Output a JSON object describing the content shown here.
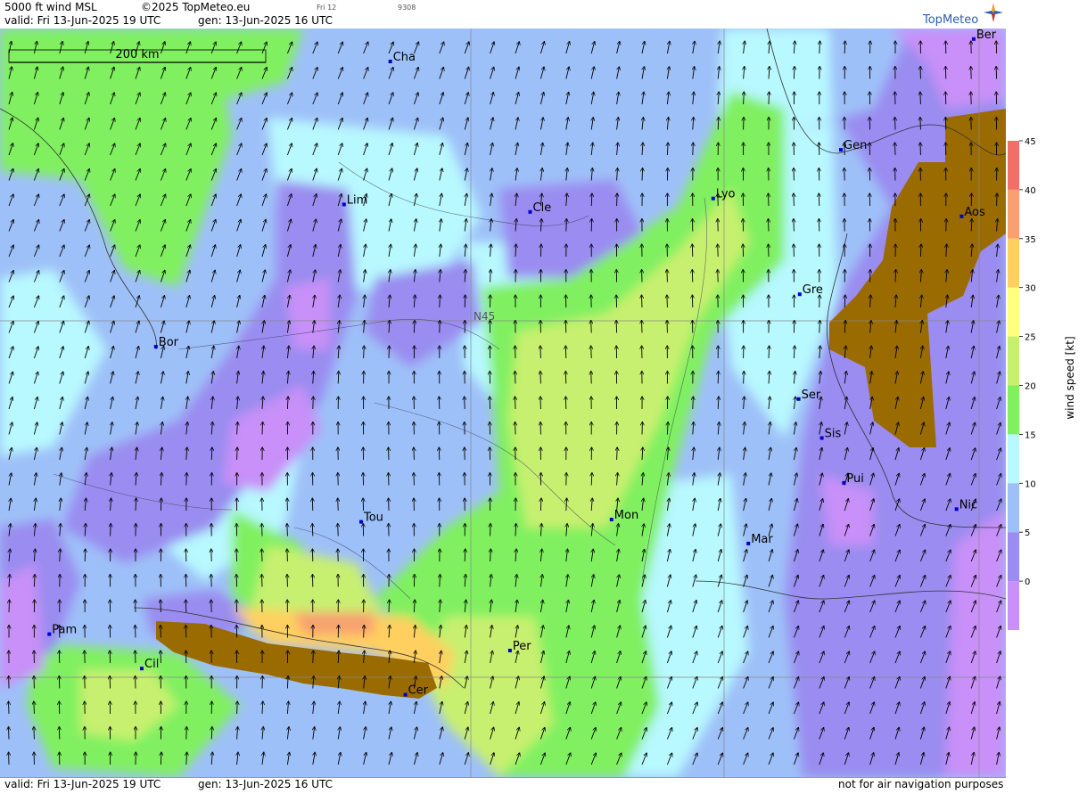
{
  "header": {
    "product": "5000 ft wind MSL",
    "copyright": "©2025 TopMeteo.eu",
    "frame_day": "Fri 12",
    "frame_code": "9308",
    "valid": "valid:  Fri  13-Jun-2025  19 UTC",
    "gen": "gen: 13-Jun-2025 16 UTC"
  },
  "footer": {
    "valid": "valid:  Fri  13-Jun-2025  19 UTC",
    "gen": "gen: 13-Jun-2025 16 UTC",
    "disclaimer": "not for air navigation purposes"
  },
  "logo": {
    "text": "TopMeteo"
  },
  "scale_bar": {
    "label": "200 km"
  },
  "grid_label": "N45",
  "legend": {
    "title": "wind speed [kt]",
    "ticks": [
      "45",
      "40",
      "35",
      "30",
      "25",
      "20",
      "15",
      "10",
      "5",
      "0"
    ],
    "colors": [
      "#f07068",
      "#f8a070",
      "#ffd060",
      "#ffff80",
      "#c8f070",
      "#80f060",
      "#b8f8ff",
      "#9ec0f8",
      "#9a8cf0",
      "#c890f8"
    ]
  },
  "cities": [
    {
      "name": "Cha",
      "fx": 0.388,
      "fy": 0.044
    },
    {
      "name": "Ber",
      "fx": 0.968,
      "fy": 0.014
    },
    {
      "name": "Gen",
      "fx": 0.836,
      "fy": 0.162
    },
    {
      "name": "Lim",
      "fx": 0.342,
      "fy": 0.235
    },
    {
      "name": "Cle",
      "fx": 0.527,
      "fy": 0.245
    },
    {
      "name": "Lyo",
      "fx": 0.709,
      "fy": 0.227
    },
    {
      "name": "Aos",
      "fx": 0.956,
      "fy": 0.251
    },
    {
      "name": "Gre",
      "fx": 0.795,
      "fy": 0.355
    },
    {
      "name": "Bor",
      "fx": 0.155,
      "fy": 0.425
    },
    {
      "name": "Ser",
      "fx": 0.794,
      "fy": 0.495
    },
    {
      "name": "Sis",
      "fx": 0.817,
      "fy": 0.547
    },
    {
      "name": "Pui",
      "fx": 0.839,
      "fy": 0.607
    },
    {
      "name": "Nic",
      "fx": 0.951,
      "fy": 0.642
    },
    {
      "name": "Tou",
      "fx": 0.359,
      "fy": 0.659
    },
    {
      "name": "Mon",
      "fx": 0.608,
      "fy": 0.656
    },
    {
      "name": "Mar",
      "fx": 0.744,
      "fy": 0.688
    },
    {
      "name": "Pam",
      "fx": 0.049,
      "fy": 0.809
    },
    {
      "name": "Cil",
      "fx": 0.141,
      "fy": 0.855
    },
    {
      "name": "Per",
      "fx": 0.507,
      "fy": 0.831
    },
    {
      "name": "Cer",
      "fx": 0.403,
      "fy": 0.89
    }
  ]
}
